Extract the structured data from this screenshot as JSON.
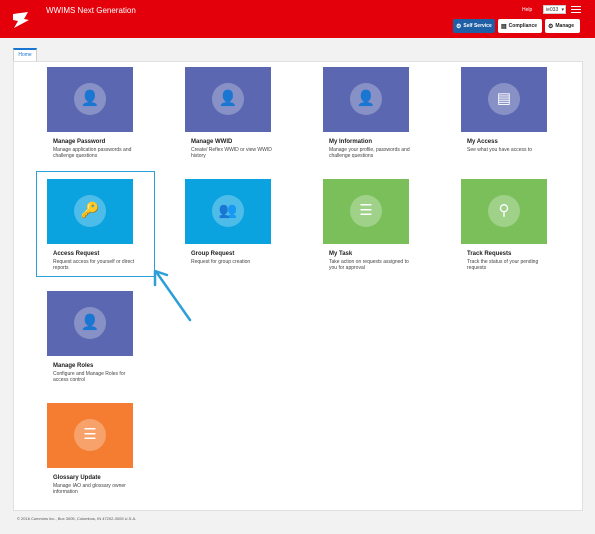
{
  "header": {
    "app_title": "WWIMS Next Generation",
    "help_label": "Help",
    "user_id": "ie033",
    "buttons": {
      "self_service": "Self Service",
      "compliance": "Compliance",
      "manage": "Manage"
    }
  },
  "tabs": {
    "home": "Home"
  },
  "tiles": [
    {
      "title": "Manage Password",
      "desc": "Manage application passwords and challenge questions",
      "color": "#5b67b1",
      "icon": "user-lock-icon"
    },
    {
      "title": "Manage WWID",
      "desc": "Create/ Reflex WWID or view WWID history",
      "color": "#5b67b1",
      "icon": "user-edit-icon"
    },
    {
      "title": "My Information",
      "desc": "Manage your profile, passwords and challenge questions",
      "color": "#5b67b1",
      "icon": "user-info-icon"
    },
    {
      "title": "My Access",
      "desc": "See what you have access to",
      "color": "#5b67b1",
      "icon": "clipboard-icon"
    },
    {
      "title": "Access Request",
      "desc": "Request access for yourself or direct reports",
      "color": "#0aa3e0",
      "icon": "key-badge-icon"
    },
    {
      "title": "Group Request",
      "desc": "Request for group creation",
      "color": "#0aa3e0",
      "icon": "group-icon"
    },
    {
      "title": "My Task",
      "desc": "Take action on requests assigned to you for approval",
      "color": "#7abf5a",
      "icon": "task-list-icon"
    },
    {
      "title": "Track Requests",
      "desc": "Track the status of your pending requests",
      "color": "#7abf5a",
      "icon": "magnifier-icon"
    },
    {
      "title": "Manage Roles",
      "desc": "Configure and Manage Roles for access control",
      "color": "#5b67b1",
      "icon": "user-gear-icon"
    },
    {
      "title": "Glossary Update",
      "desc": "Manage IAO and glossary owner information",
      "color": "#f47d32",
      "icon": "list-icon"
    }
  ],
  "footer": "© 2016 Cummins Inc., Box 3005, Columbus, IN 47202-3005 U.S.A."
}
